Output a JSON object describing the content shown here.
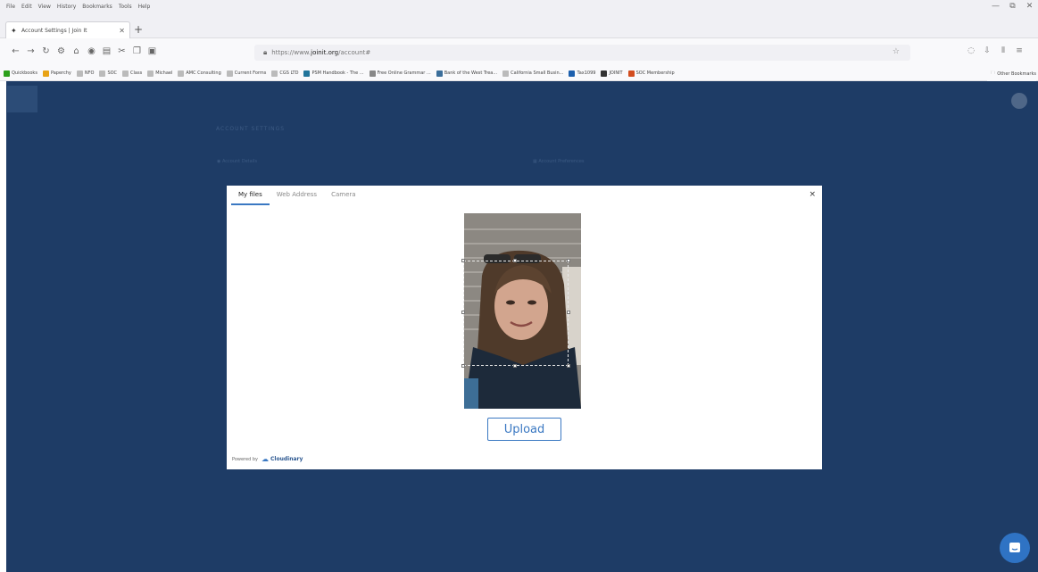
{
  "menubar": {
    "items": [
      "File",
      "Edit",
      "View",
      "History",
      "Bookmarks",
      "Tools",
      "Help"
    ],
    "minimize": "—",
    "maximize": "⧉",
    "close": "✕"
  },
  "tab": {
    "title": "Account Settings | Join It",
    "close": "✕",
    "new_tab": "+"
  },
  "nav": {
    "back": "←",
    "forward": "→",
    "reload": "↻",
    "url_prefix": "https://www.",
    "url_domain": "joinit.org",
    "url_path": "/account#",
    "star": "☆"
  },
  "bookmarks": [
    {
      "label": "Quickbooks",
      "color": "#2ca01c"
    },
    {
      "label": "Paperchy",
      "color": "#e8a317"
    },
    {
      "label": "NFO",
      "color": "#bbbbbb"
    },
    {
      "label": "SOC",
      "color": "#bbbbbb"
    },
    {
      "label": "Class",
      "color": "#bbbbbb"
    },
    {
      "label": "Michael",
      "color": "#bbbbbb"
    },
    {
      "label": "AMC Consulting",
      "color": "#bbbbbb"
    },
    {
      "label": "Current Forms",
      "color": "#bbbbbb"
    },
    {
      "label": "CGS LTD",
      "color": "#bbbbbb"
    },
    {
      "label": "PSM Handbook - The ...",
      "color": "#21759b"
    },
    {
      "label": "Free Online Grammar ...",
      "color": "#888888"
    },
    {
      "label": "Bank of the West Trea...",
      "color": "#3b6e9a"
    },
    {
      "label": "California Small Busin...",
      "color": "#bbbbbb"
    },
    {
      "label": "Tax1099",
      "color": "#1c5fad"
    },
    {
      "label": "JOINIT",
      "color": "#333333"
    },
    {
      "label": "SOC Membership",
      "color": "#d24d1f"
    }
  ],
  "other_bookmarks": "Other Bookmarks",
  "page": {
    "title": "ACCOUNT SETTINGS",
    "option1": "Account Details",
    "option2": "Account Preferences"
  },
  "modal": {
    "tabs": [
      {
        "label": "My files",
        "active": true
      },
      {
        "label": "Web Address",
        "active": false
      },
      {
        "label": "Camera",
        "active": false
      }
    ],
    "close": "×",
    "upload_label": "Upload",
    "powered_by": "Powered by",
    "brand": "Cloudinary"
  },
  "colors": {
    "page_bg": "#1e3c66",
    "accent": "#3a78c2",
    "chat_button": "#2f73c4"
  }
}
